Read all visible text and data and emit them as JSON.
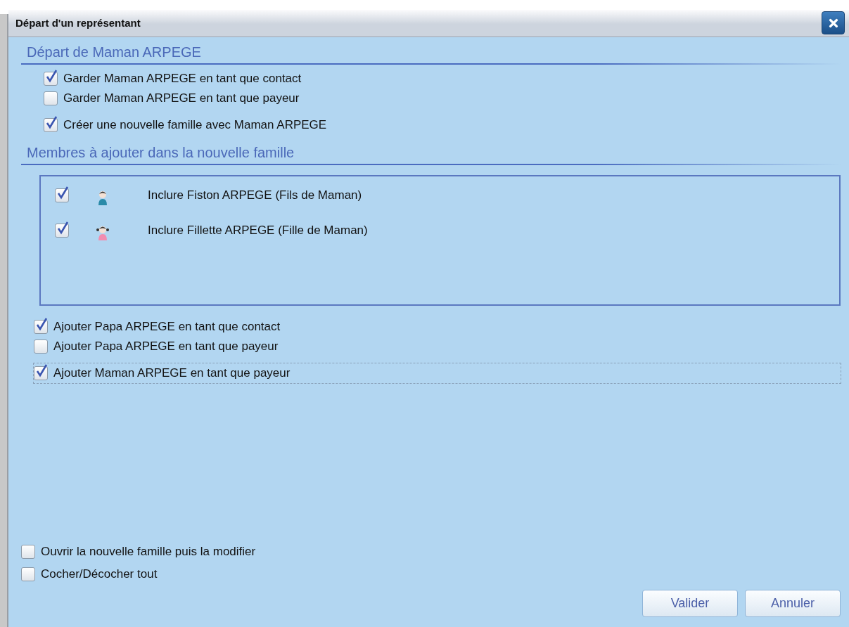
{
  "window": {
    "title": "Départ d'un représentant"
  },
  "departure": {
    "heading": "Départ de Maman ARPEGE",
    "options": [
      {
        "label": "Garder Maman ARPEGE en tant que contact",
        "checked": true
      },
      {
        "label": "Garder Maman ARPEGE en tant que payeur",
        "checked": false
      },
      {
        "label": "Créer une nouvelle famille avec Maman ARPEGE",
        "checked": true
      }
    ]
  },
  "members": {
    "heading": "Membres à ajouter dans la nouvelle famille",
    "items": [
      {
        "kind": "boy",
        "label": "Inclure Fiston ARPEGE (Fils de Maman)",
        "checked": true
      },
      {
        "kind": "girl",
        "label": "Inclure Fillette ARPEGE (Fille de Maman)",
        "checked": true
      }
    ]
  },
  "additions": [
    {
      "label": "Ajouter Papa ARPEGE en tant que contact",
      "checked": true,
      "focused": false
    },
    {
      "label": "Ajouter Papa ARPEGE en tant que payeur",
      "checked": false,
      "focused": false
    },
    {
      "label": "Ajouter Maman ARPEGE en tant que payeur",
      "checked": true,
      "focused": true
    }
  ],
  "footer_options": [
    {
      "label": "Ouvrir la nouvelle famille puis la modifier",
      "checked": false
    },
    {
      "label": "Cocher/Décocher tout",
      "checked": false
    }
  ],
  "buttons": [
    "Valider",
    "Annuler"
  ]
}
